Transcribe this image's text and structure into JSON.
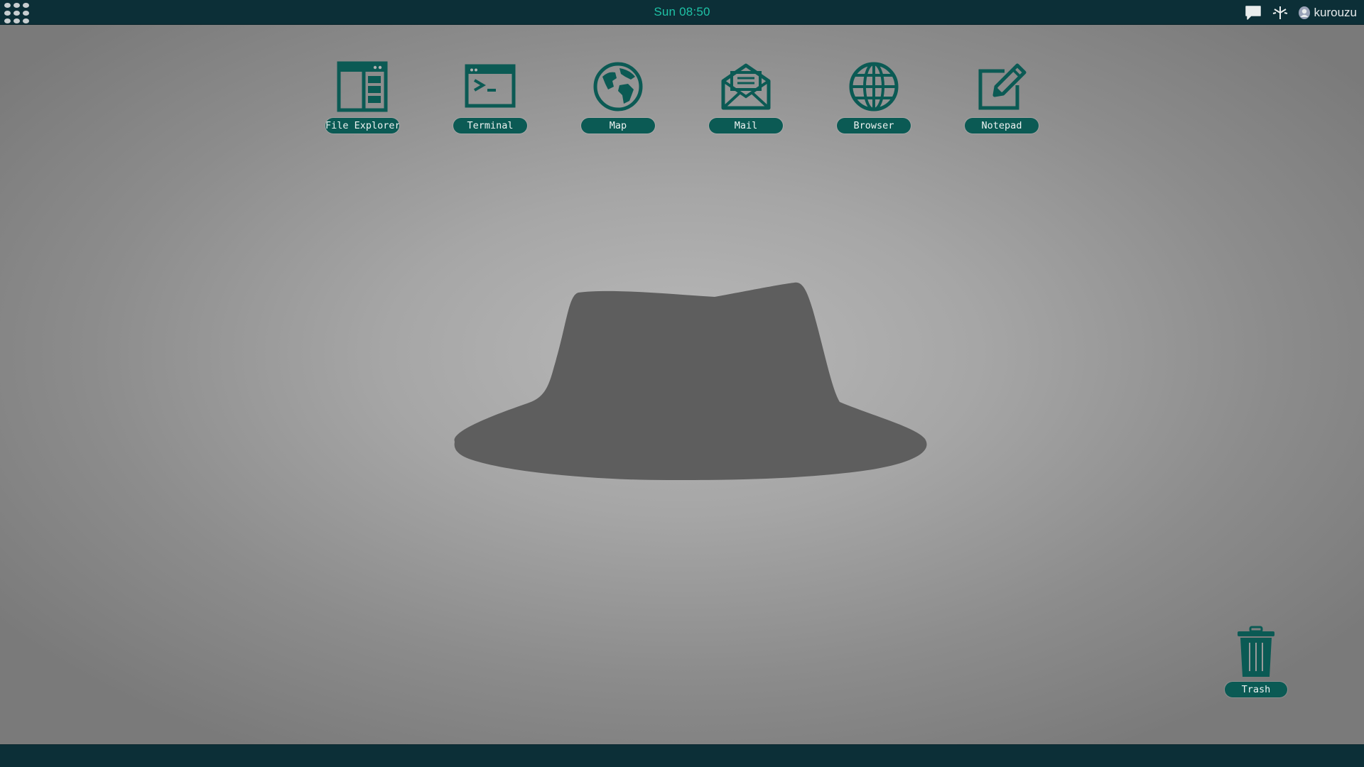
{
  "topbar": {
    "clock": "Sun 08:50",
    "username": "kurouzu",
    "tray_icons": [
      "chat-icon",
      "network-icon",
      "user-icon"
    ]
  },
  "desktop": {
    "icons": [
      {
        "label": "File Explorer",
        "icon": "file-explorer-icon"
      },
      {
        "label": "Terminal",
        "icon": "terminal-icon"
      },
      {
        "label": "Map",
        "icon": "globe-map-icon"
      },
      {
        "label": "Mail",
        "icon": "mail-icon"
      },
      {
        "label": "Browser",
        "icon": "browser-globe-icon"
      },
      {
        "label": "Notepad",
        "icon": "notepad-icon"
      }
    ],
    "trash": {
      "label": "Trash",
      "icon": "trash-icon"
    },
    "wallpaper": "fedora-hat"
  },
  "colors": {
    "bar": "#0c2f37",
    "accent": "#1fc2a6",
    "icon": "#0b5a54",
    "label_bg": "#0b5a54",
    "hat": "#5e5e5e"
  }
}
